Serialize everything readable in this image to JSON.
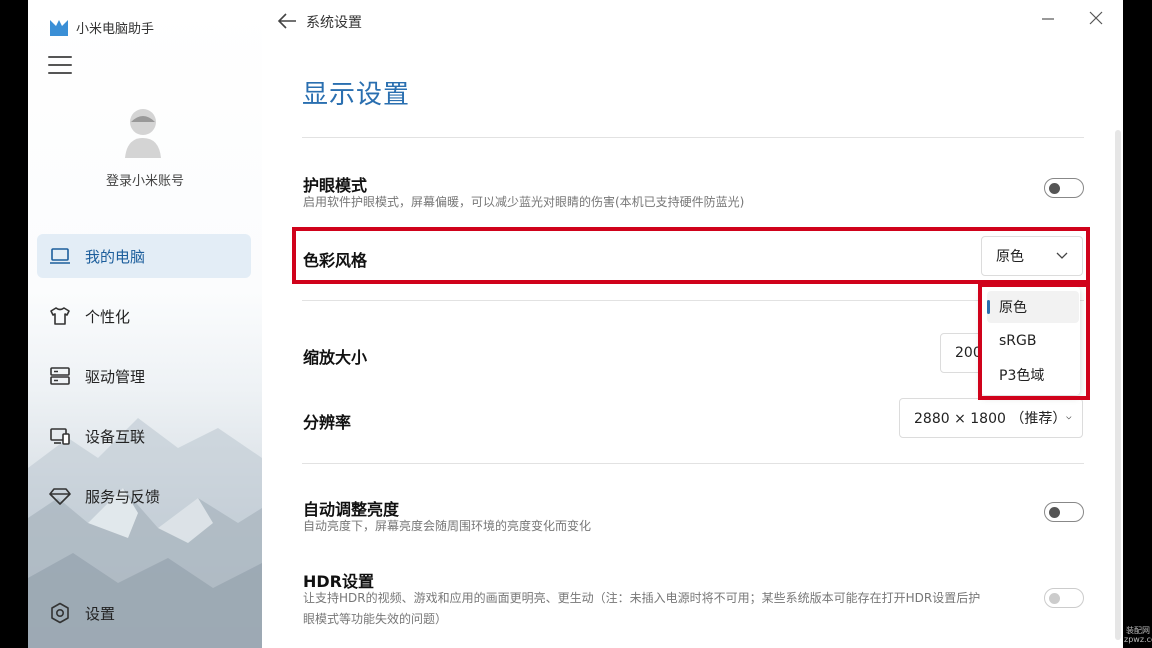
{
  "app": {
    "title": "小米电脑助手"
  },
  "topbar": {
    "title": "系统设置"
  },
  "account": {
    "login_label": "登录小米账号"
  },
  "nav": {
    "items": [
      {
        "label": "我的电脑",
        "icon": "laptop-icon",
        "active": true
      },
      {
        "label": "个性化",
        "icon": "tshirt-icon",
        "active": false
      },
      {
        "label": "驱动管理",
        "icon": "drive-icon",
        "active": false
      },
      {
        "label": "设备互联",
        "icon": "devices-icon",
        "active": false
      },
      {
        "label": "服务与反馈",
        "icon": "diamond-icon",
        "active": false
      }
    ],
    "settings_label": "设置"
  },
  "page": {
    "title": "显示设置"
  },
  "settings": {
    "eye_protection": {
      "label": "护眼模式",
      "desc": "启用软件护眼模式，屏幕偏暖，可以减少蓝光对眼睛的伤害(本机已支持硬件防蓝光)",
      "on": false
    },
    "color_style": {
      "label": "色彩风格",
      "value": "原色",
      "options": [
        "原色",
        "sRGB",
        "P3色域"
      ],
      "selected": 0
    },
    "scale": {
      "label": "缩放大小",
      "value": "200"
    },
    "resolution": {
      "label": "分辨率",
      "value": "2880 × 1800 （推荐）"
    },
    "auto_brightness": {
      "label": "自动调整亮度",
      "desc": "自动亮度下，屏幕亮度会随周围环境的亮度变化而变化",
      "on": false
    },
    "hdr": {
      "label": "HDR设置",
      "desc_line1": "让支持HDR的视频、游戏和应用的画面更明亮、更生动（注：未插入电源时将不可用；某些系统版本可能存在打开HDR设置后护",
      "desc_line2": "眼模式等功能失效的问题）",
      "on": false,
      "disabled": true
    }
  },
  "colors": {
    "accent": "#2a6fb0",
    "highlight": "#d0021b",
    "nav_active_bg": "#e3edf6"
  },
  "watermark": {
    "line1": "装配网",
    "line2": "zpwz.com"
  }
}
